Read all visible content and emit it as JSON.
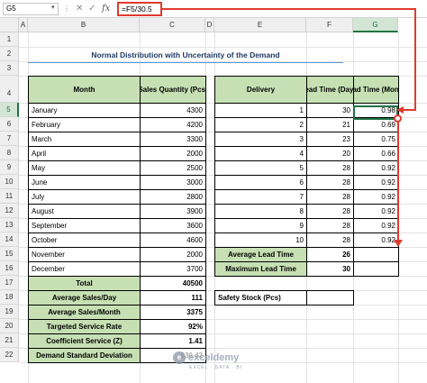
{
  "formula_bar": {
    "name_box": "G5",
    "name_box_arrow": "▾",
    "dots": "⋮",
    "cancel_icon": "✕",
    "enter_icon": "✓",
    "fx_label": "fx",
    "formula": "=F5/30.5"
  },
  "columns": [
    "A",
    "B",
    "C",
    "D",
    "E",
    "F",
    "G"
  ],
  "rows": [
    "1",
    "2",
    "3",
    "4",
    "5",
    "6",
    "7",
    "8",
    "9",
    "10",
    "11",
    "12",
    "13",
    "14",
    "15",
    "16",
    "17",
    "18",
    "19",
    "20",
    "21",
    "22"
  ],
  "title": "Normal Distribution with Uncertainty of the Demand",
  "sales_table": {
    "header_month": "Month",
    "header_qty": "Sales Quantity (Pcs)",
    "rows": [
      {
        "month": "January",
        "qty": "4300"
      },
      {
        "month": "February",
        "qty": "4200"
      },
      {
        "month": "March",
        "qty": "3300"
      },
      {
        "month": "April",
        "qty": "2000"
      },
      {
        "month": "May",
        "qty": "2500"
      },
      {
        "month": "June",
        "qty": "3000"
      },
      {
        "month": "July",
        "qty": "2800"
      },
      {
        "month": "August",
        "qty": "3900"
      },
      {
        "month": "September",
        "qty": "3600"
      },
      {
        "month": "October",
        "qty": "4600"
      },
      {
        "month": "November",
        "qty": "2000"
      },
      {
        "month": "December",
        "qty": "3700"
      }
    ]
  },
  "summary": [
    {
      "label": "Total",
      "value": "40500"
    },
    {
      "label": "Average Sales/Day",
      "value": "111"
    },
    {
      "label": "Average Sales/Month",
      "value": "3375"
    },
    {
      "label": "Targeted Service Rate",
      "value": "92%"
    },
    {
      "label": "Coefficient Service (Z)",
      "value": "1.41"
    },
    {
      "label": "Demand Standard Deviation",
      "value": "930.42"
    }
  ],
  "delivery_table": {
    "header_delivery": "Delivery",
    "header_lead_days": "Lead Time (Days)",
    "header_lead_month": "Lead Time (Month)",
    "rows": [
      {
        "delivery": "1",
        "days": "30",
        "month": "0.98"
      },
      {
        "delivery": "2",
        "days": "21",
        "month": "0.69"
      },
      {
        "delivery": "3",
        "days": "23",
        "month": "0.75"
      },
      {
        "delivery": "4",
        "days": "20",
        "month": "0.66"
      },
      {
        "delivery": "5",
        "days": "28",
        "month": "0.92"
      },
      {
        "delivery": "6",
        "days": "28",
        "month": "0.92"
      },
      {
        "delivery": "7",
        "days": "28",
        "month": "0.92"
      },
      {
        "delivery": "8",
        "days": "28",
        "month": "0.92"
      },
      {
        "delivery": "9",
        "days": "28",
        "month": "0.92"
      },
      {
        "delivery": "10",
        "days": "28",
        "month": "0.92"
      }
    ]
  },
  "lead_summary": [
    {
      "label": "Average Lead Time",
      "value": "26"
    },
    {
      "label": "Maximum Lead Time",
      "value": "30"
    }
  ],
  "safety_stock_label": "Safety Stock (Pcs)",
  "watermark": {
    "logo_letter": "e",
    "name": "exceldemy",
    "tagline": "EXCEL · DATA · BI"
  },
  "colors": {
    "header_green": "#c6e0b4",
    "annotation_red": "#e03a2f",
    "excel_green": "#217346"
  }
}
